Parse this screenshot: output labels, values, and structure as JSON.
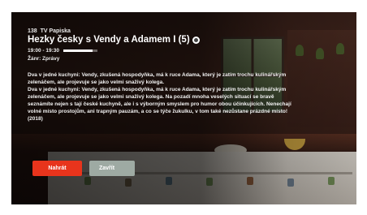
{
  "channel": {
    "number": "138",
    "name": "TV Papiska"
  },
  "program": {
    "title": "Hezky česky s Vendy a Adamem I (5)",
    "time": "19:00 - 19:30",
    "progress": 0.85,
    "genre": "Žánr: Zprávy",
    "description": [
      "Dva v jedné kuchyni: Vendy, zkušená hospodyňka, má k ruce Adama, který je zatím trochu kulinářským zelenáčem, ale projevuje se jako velmi snaživý kolega.",
      "Dva v jedné kuchyni: Vendy, zkušená hospodyňka, má k ruce Adama, který je zatím trochu kulinářským zelenáčem, ale projevuje se jako velmi snaživý kolega. Na pozadí mnoha veselých situací se bravě seznámíte nejen s tají české kuchyně, ale i s výborným smyslem pro humor obou účinkujících. Nenechají volné místo prostojům, ani trapným pauzám, a co se týče žukulku, v tom také nezůstane prázdné místo! (2018)"
    ]
  },
  "buttons": {
    "play": "Nahrát",
    "close": "Zavřít"
  },
  "colors": {
    "play_button": "#e8341c",
    "close_button": "#9eaaa3"
  },
  "icons": {
    "title_badge": "info-circle-icon"
  }
}
